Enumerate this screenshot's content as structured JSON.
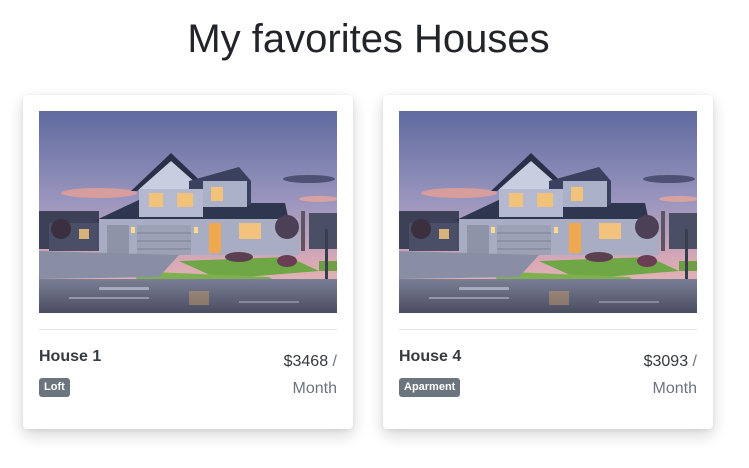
{
  "page": {
    "title": "My favorites Houses"
  },
  "cards": [
    {
      "image_icon": "house-photo",
      "name": "House 1",
      "type": "Loft",
      "price": "$3468",
      "price_sep": " /",
      "period": "Month"
    },
    {
      "image_icon": "house-photo",
      "name": "House 4",
      "type": "Aparment",
      "price": "$3093",
      "price_sep": " /",
      "period": "Month"
    }
  ],
  "colors": {
    "badge_bg": "#6c757d",
    "text_dark": "#343a40",
    "text_muted": "#6c757d",
    "sky_top": "#6a74a8",
    "sky_bottom": "#e6b3b8"
  }
}
